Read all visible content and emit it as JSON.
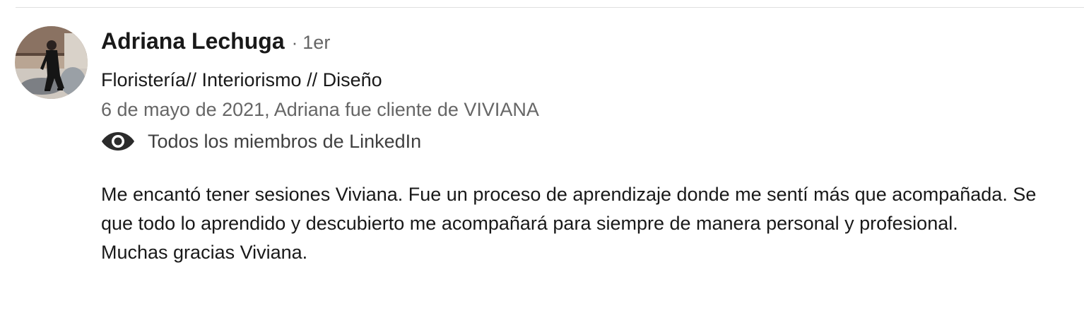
{
  "recommendation": {
    "author": {
      "name": "Adriana Lechuga",
      "separator": "·",
      "connection_degree": "1er",
      "headline": "Floristería// Interiorismo // Diseño",
      "avatar_icon": "profile-photo"
    },
    "meta": "6 de mayo de 2021, Adriana fue cliente de VIVIANA",
    "visibility": {
      "icon": "eye-icon",
      "label": "Todos los miembros de LinkedIn"
    },
    "body": {
      "paragraph_1": "Me encantó tener sesiones Viviana. Fue un proceso de aprendizaje donde me sentí más que acompañada. Se que todo lo aprendido y descubierto me acompañará para siempre de manera personal y profesional.",
      "paragraph_2": "Muchas gracias Viviana."
    }
  },
  "colors": {
    "text_primary": "#191919",
    "text_secondary": "#666666",
    "divider": "#e0e0e0"
  }
}
